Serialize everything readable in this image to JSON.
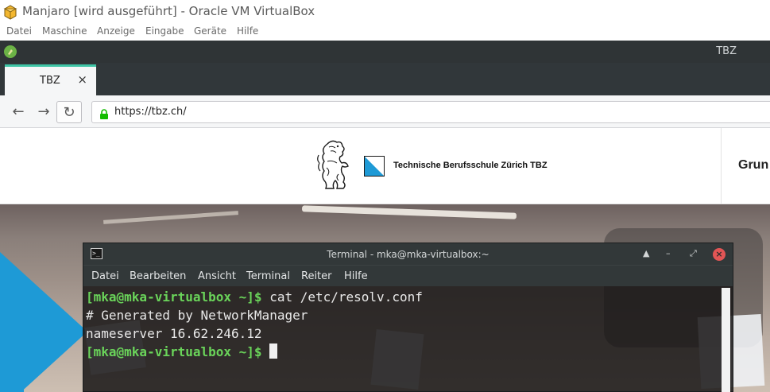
{
  "host_window": {
    "title": "Manjaro [wird ausgeführt] - Oracle VM VirtualBox",
    "menu": [
      "Datei",
      "Maschine",
      "Anzeige",
      "Eingabe",
      "Geräte",
      "Hilfe"
    ]
  },
  "guest_panel": {
    "label": "TBZ"
  },
  "browser": {
    "tab_title": "TBZ",
    "tab_close": "×",
    "url": "https://tbz.ch/",
    "back_icon": "←",
    "forward_icon": "→",
    "reload_icon": "↻"
  },
  "website": {
    "school_name": "Technische Berufsschule Zürich TBZ",
    "nav_partial": "Grun"
  },
  "terminal": {
    "title": "Terminal - mka@mka-virtualbox:~",
    "controls": [
      "▲",
      "–",
      "⤢",
      "×"
    ],
    "menu": [
      "Datei",
      "Bearbeiten",
      "Ansicht",
      "Terminal",
      "Reiter",
      "Hilfe"
    ],
    "lines": [
      {
        "prompt": "[mka@mka-virtualbox ~]$",
        "text": " cat /etc/resolv.conf"
      },
      {
        "prompt": "",
        "text": "# Generated by NetworkManager"
      },
      {
        "prompt": "",
        "text": "nameserver 16.62.246.12"
      },
      {
        "prompt": "[mka@mka-virtualbox ~]$",
        "text": " "
      }
    ]
  },
  "colors": {
    "tab_accent": "#3fc5a6",
    "prompt_green": "#6ad45a",
    "zurich_blue": "#1e9ad6",
    "close_red": "#e25555"
  }
}
